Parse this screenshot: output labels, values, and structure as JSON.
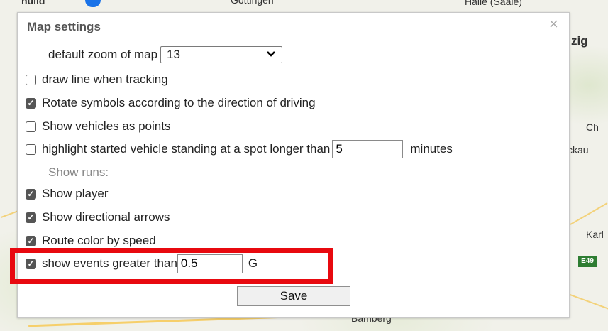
{
  "map": {
    "labels": {
      "top_left": "hüiid",
      "top_center": "Göttingen",
      "top_right": "Halle (Saale)",
      "right_1": "zig",
      "right_2": "Ch",
      "right_3": "ckau",
      "right_4": "Karl",
      "bottom": "Bamberg",
      "road_badge": "E49"
    }
  },
  "dialog": {
    "title": "Map settings",
    "close_glyph": "×",
    "zoom": {
      "label": "default zoom of map",
      "value": "13"
    },
    "options": [
      {
        "label": "draw line when tracking",
        "checked": false
      },
      {
        "label": "Rotate symbols according to the direction of driving",
        "checked": true
      },
      {
        "label": "Show vehicles as points",
        "checked": false
      }
    ],
    "standing": {
      "label": "highlight started vehicle standing at a spot longer than",
      "value": "5",
      "unit": "minutes",
      "checked": false
    },
    "runs_header": "Show runs:",
    "run_options": [
      {
        "label": "Show player",
        "checked": true
      },
      {
        "label": "Show directional arrows",
        "checked": true
      },
      {
        "label": "Route color by speed",
        "checked": true
      }
    ],
    "events": {
      "label": "show events greater than",
      "value": "0.5",
      "unit": "G",
      "checked": true
    },
    "save_label": "Save"
  }
}
